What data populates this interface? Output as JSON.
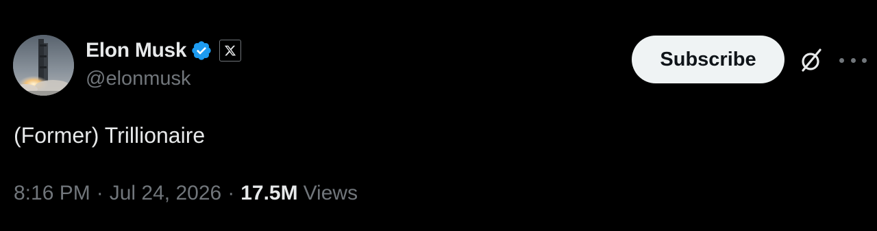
{
  "post": {
    "author": {
      "display_name": "Elon Musk",
      "handle": "@elonmusk",
      "verified_icon": "verified-badge-icon",
      "affiliation_icon": "x-logo-icon"
    },
    "subscribe_label": "Subscribe",
    "text": "(Former) Trillionaire",
    "time": "8:16 PM",
    "separator": "·",
    "date": "Jul 24, 2026",
    "views_count": "17.5M",
    "views_label": "Views"
  },
  "colors": {
    "background": "#000000",
    "primary_text": "#e7e9ea",
    "secondary_text": "#71767b",
    "verified_blue": "#1d9bf0",
    "subscribe_bg": "#eff3f4"
  },
  "icons": {
    "grok": "grok-icon",
    "more": "more-options-icon"
  }
}
